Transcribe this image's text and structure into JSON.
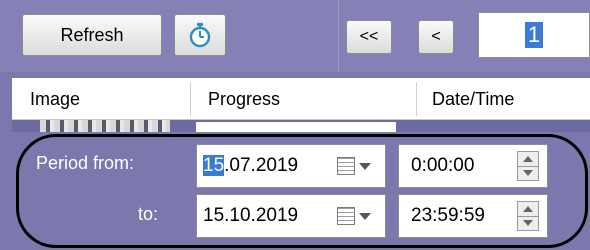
{
  "toolbar": {
    "refresh_label": "Refresh",
    "timer_icon": "stopwatch-icon",
    "nav_first_label": "<<",
    "nav_prev_label": "<",
    "page_value": "1"
  },
  "table": {
    "columns": [
      "Image",
      "Progress",
      "Date/Time"
    ]
  },
  "filter": {
    "from_label": "Period from:",
    "to_label": "to:",
    "from_date_selected": "15",
    "from_date_rest": ".07.2019",
    "from_time": "0:00:00",
    "to_date": "15.10.2019",
    "to_time": "23:59:59"
  },
  "colors": {
    "panel": "#7c77ad",
    "selection": "#3a7bd5",
    "highlight_ring": "#000000"
  }
}
